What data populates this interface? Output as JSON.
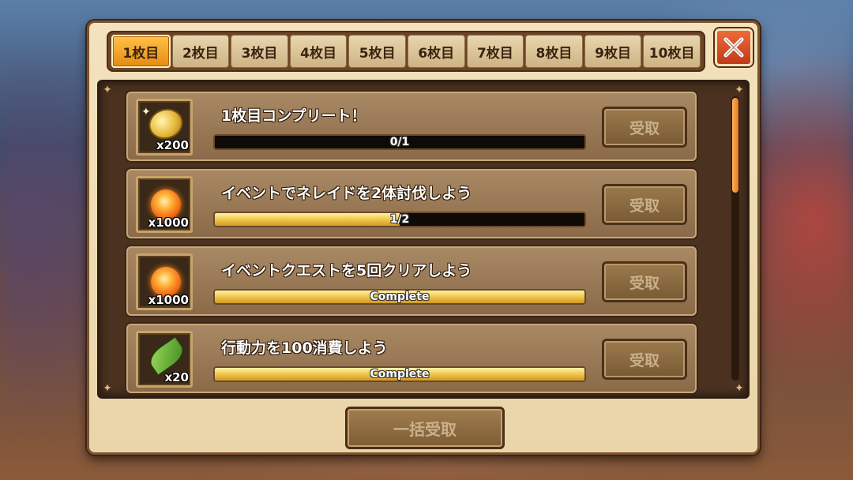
{
  "tabs": [
    {
      "label": "1枚目",
      "active": true
    },
    {
      "label": "2枚目"
    },
    {
      "label": "3枚目"
    },
    {
      "label": "4枚目"
    },
    {
      "label": "5枚目"
    },
    {
      "label": "6枚目"
    },
    {
      "label": "7枚目"
    },
    {
      "label": "8枚目"
    },
    {
      "label": "9枚目"
    },
    {
      "label": "10枚目"
    }
  ],
  "missions": [
    {
      "title": "1枚目コンプリート！",
      "reward_icon": "gold-coin-icon",
      "reward_qty": "x200",
      "progress_text": "0/1",
      "progress": 0.0,
      "claim_label": "受取"
    },
    {
      "title": "イベントでネレイドを2体討伐しよう",
      "reward_icon": "orange-orb-icon",
      "reward_qty": "x1000",
      "progress_text": "1/2",
      "progress": 0.5,
      "claim_label": "受取"
    },
    {
      "title": "イベントクエストを5回クリアしよう",
      "reward_icon": "orange-orb-icon",
      "reward_qty": "x1000",
      "progress_text": "Complete",
      "progress": 1.0,
      "claim_label": "受取"
    },
    {
      "title": "行動力を100消費しよう",
      "reward_icon": "green-leaf-icon",
      "reward_qty": "x20",
      "progress_text": "Complete",
      "progress": 1.0,
      "claim_label": "受取"
    }
  ],
  "bulk_claim_label": "一括受取",
  "colors": {
    "accent": "#f0a020",
    "close": "#d84a22",
    "panel": "#4a3120"
  }
}
